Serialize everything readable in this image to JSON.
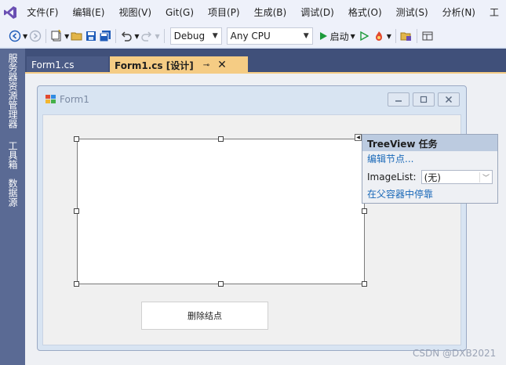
{
  "menu": {
    "items": [
      "文件(F)",
      "编辑(E)",
      "视图(V)",
      "Git(G)",
      "项目(P)",
      "生成(B)",
      "调试(D)",
      "格式(O)",
      "测试(S)",
      "分析(N)",
      "工"
    ]
  },
  "toolbar": {
    "config": "Debug",
    "platform": "Any CPU",
    "start_label": "启动"
  },
  "left_strip": {
    "tabs": [
      "服务器资源管理器",
      "工具箱",
      "数据源"
    ]
  },
  "doc_tabs": {
    "inactive": "Form1.cs",
    "active": "Form1.cs [设计]",
    "pin": "⊸",
    "close": "✕"
  },
  "form": {
    "title": "Form1"
  },
  "tasks_panel": {
    "title": "TreeView 任务",
    "edit_nodes": "编辑节点...",
    "imagelist_label": "ImageList:",
    "imagelist_value": "(无)",
    "dock": "在父容器中停靠"
  },
  "button": {
    "delete_label": "删除结点"
  },
  "watermark": "CSDN @DXB2021",
  "colors": {
    "accent_tab": "#f5cc84",
    "side_strip": "#5a6a94",
    "link": "#1a69b8"
  }
}
